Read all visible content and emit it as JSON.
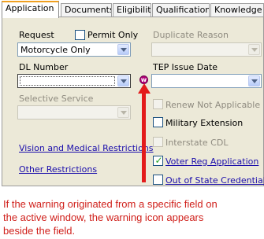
{
  "tabs": [
    {
      "label": "Application",
      "active": true
    },
    {
      "label": "Documents",
      "active": false
    },
    {
      "label": "Eligibility",
      "active": false
    },
    {
      "label": "Qualifications",
      "active": false
    },
    {
      "label": "Knowledge",
      "active": false
    }
  ],
  "form": {
    "request": {
      "label": "Request",
      "value": "Motorcycle Only"
    },
    "permit_only": {
      "label": "Permit Only",
      "checked": false
    },
    "duplicate_reason": {
      "label": "Duplicate Reason",
      "value": "",
      "disabled": true
    },
    "dl_number": {
      "label": "DL Number",
      "value": ""
    },
    "tep_issue_date": {
      "label": "TEP Issue Date",
      "value": ""
    },
    "selective_service": {
      "label": "Selective Service",
      "value": "",
      "disabled": true
    },
    "checkboxes": [
      {
        "label": "Renew Not Applicable",
        "checked": false,
        "disabled": true,
        "link": false
      },
      {
        "label": "Military Extension",
        "checked": false,
        "disabled": false,
        "link": false
      },
      {
        "label": "Interstate CDL",
        "checked": false,
        "disabled": true,
        "link": false
      },
      {
        "label": "Voter Reg Application",
        "checked": true,
        "disabled": false,
        "link": true
      },
      {
        "label": "Out of State Credential",
        "checked": false,
        "disabled": false,
        "link": true
      }
    ],
    "links": {
      "vision": "Vision and Medical Restrictions",
      "other": "Other Restrictions"
    }
  },
  "warning_icon": {
    "glyph": "w",
    "color": "#b3007a"
  },
  "annotation": {
    "caption": "If the warning originated from a specific field on\nthe active window, the warning icon appears\nbeside the field.",
    "color": "#d0201b"
  }
}
